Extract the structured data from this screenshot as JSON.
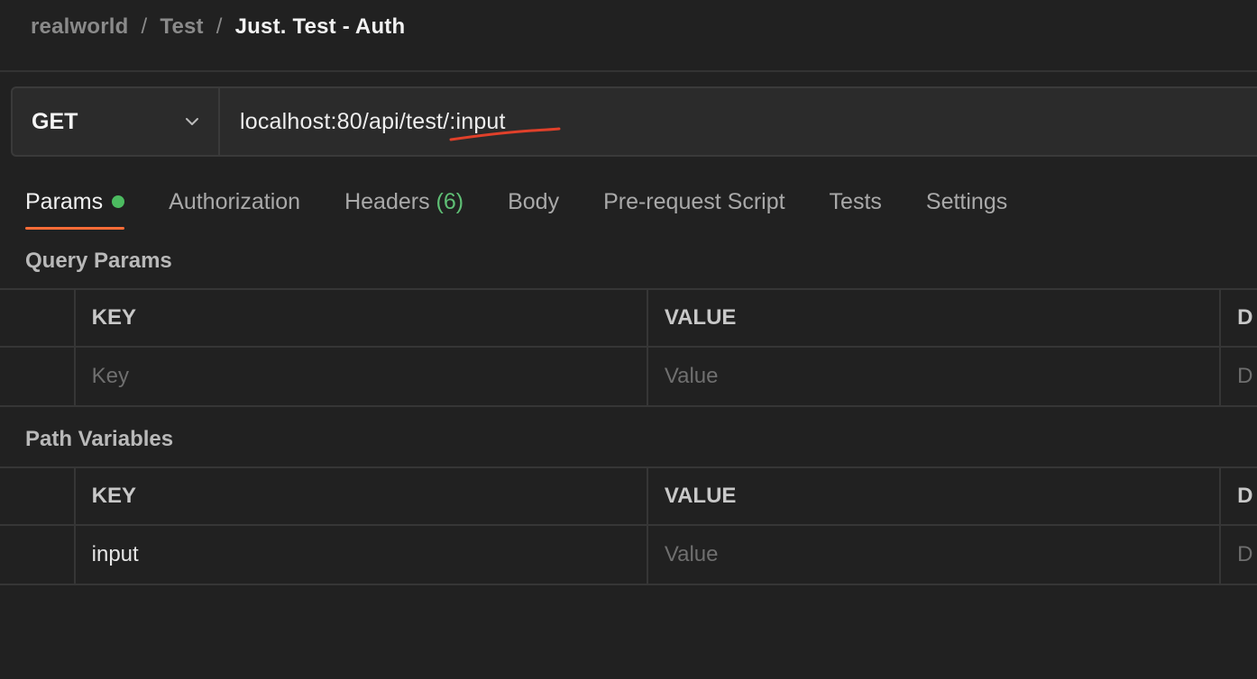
{
  "breadcrumb": {
    "workspace": "realworld",
    "collection": "Test",
    "request": "Just. Test - Auth",
    "separator": "/"
  },
  "request": {
    "method": "GET",
    "url": "localhost:80/api/test/:input"
  },
  "tabs": [
    {
      "label": "Params",
      "active": true,
      "has_indicator": true
    },
    {
      "label": "Authorization"
    },
    {
      "label": "Headers",
      "count": "(6)"
    },
    {
      "label": "Body"
    },
    {
      "label": "Pre-request Script"
    },
    {
      "label": "Tests"
    },
    {
      "label": "Settings"
    }
  ],
  "query_params": {
    "title": "Query Params",
    "columns": [
      "KEY",
      "VALUE",
      "D"
    ],
    "rows": [
      {
        "key_placeholder": "Key",
        "value_placeholder": "Value",
        "desc_placeholder": "D"
      }
    ]
  },
  "path_variables": {
    "title": "Path Variables",
    "columns": [
      "KEY",
      "VALUE",
      "D"
    ],
    "rows": [
      {
        "key": "input",
        "value_placeholder": "Value",
        "desc_placeholder": "D"
      }
    ]
  },
  "colors": {
    "background": "#212121",
    "accent": "#ff6c37",
    "indicator": "#4cbb60",
    "annotation": "#e0402a"
  }
}
